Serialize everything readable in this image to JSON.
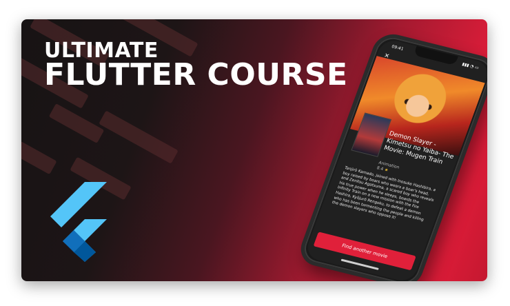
{
  "banner": {
    "title_line1": "Ultimate",
    "title_line2": "Flutter Course"
  },
  "phone": {
    "status_time": "09:41",
    "status_icons": "▮▮▮ ◔ ▭",
    "close_icon": "✕",
    "movie_title": "Demon Slayer -Kimetsu no Yaiba- The Movie: Mugen Train",
    "genre": "Animation",
    "rating": "8.4",
    "synopsis": "Tanjirō Kamado, joined with Inosuke Hashibira, a boy raised by boars who wears a boar's head, and Zenitsu Agatsuma, a scared boy who reveals his true power when he sleeps, boards the Infinity Train on a new mission with the Fire Hashira, Kyōjurō Rengoku, to defeat a demon who has been tormenting the people and killing the demon slayers who oppose it!",
    "cta_label": "Find another movie"
  },
  "colors": {
    "accent_red": "#e0203a",
    "flutter_light_blue": "#54c5f8",
    "flutter_dark_blue": "#01579b"
  }
}
